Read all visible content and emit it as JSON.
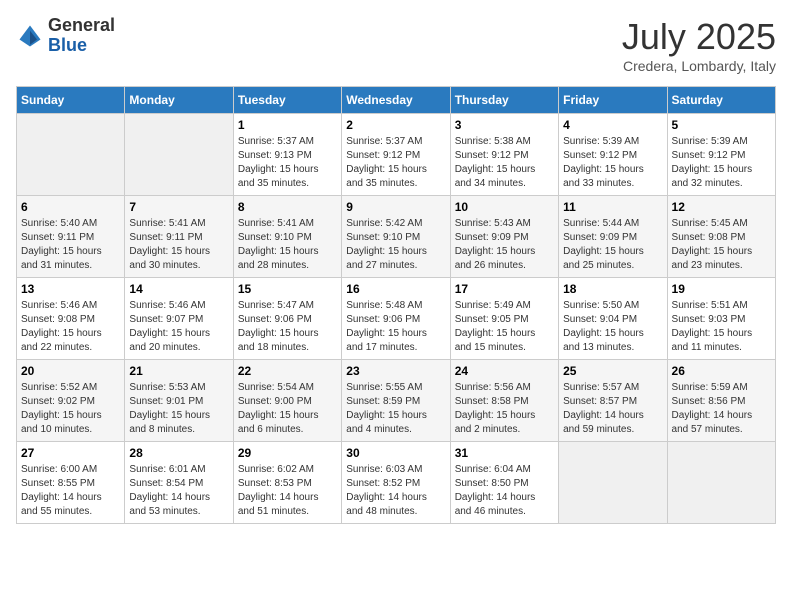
{
  "logo": {
    "general": "General",
    "blue": "Blue"
  },
  "title": "July 2025",
  "location": "Credera, Lombardy, Italy",
  "headers": [
    "Sunday",
    "Monday",
    "Tuesday",
    "Wednesday",
    "Thursday",
    "Friday",
    "Saturday"
  ],
  "weeks": [
    [
      {
        "day": "",
        "sunrise": "",
        "sunset": "",
        "daylight": ""
      },
      {
        "day": "",
        "sunrise": "",
        "sunset": "",
        "daylight": ""
      },
      {
        "day": "1",
        "sunrise": "Sunrise: 5:37 AM",
        "sunset": "Sunset: 9:13 PM",
        "daylight": "Daylight: 15 hours and 35 minutes."
      },
      {
        "day": "2",
        "sunrise": "Sunrise: 5:37 AM",
        "sunset": "Sunset: 9:12 PM",
        "daylight": "Daylight: 15 hours and 35 minutes."
      },
      {
        "day": "3",
        "sunrise": "Sunrise: 5:38 AM",
        "sunset": "Sunset: 9:12 PM",
        "daylight": "Daylight: 15 hours and 34 minutes."
      },
      {
        "day": "4",
        "sunrise": "Sunrise: 5:39 AM",
        "sunset": "Sunset: 9:12 PM",
        "daylight": "Daylight: 15 hours and 33 minutes."
      },
      {
        "day": "5",
        "sunrise": "Sunrise: 5:39 AM",
        "sunset": "Sunset: 9:12 PM",
        "daylight": "Daylight: 15 hours and 32 minutes."
      }
    ],
    [
      {
        "day": "6",
        "sunrise": "Sunrise: 5:40 AM",
        "sunset": "Sunset: 9:11 PM",
        "daylight": "Daylight: 15 hours and 31 minutes."
      },
      {
        "day": "7",
        "sunrise": "Sunrise: 5:41 AM",
        "sunset": "Sunset: 9:11 PM",
        "daylight": "Daylight: 15 hours and 30 minutes."
      },
      {
        "day": "8",
        "sunrise": "Sunrise: 5:41 AM",
        "sunset": "Sunset: 9:10 PM",
        "daylight": "Daylight: 15 hours and 28 minutes."
      },
      {
        "day": "9",
        "sunrise": "Sunrise: 5:42 AM",
        "sunset": "Sunset: 9:10 PM",
        "daylight": "Daylight: 15 hours and 27 minutes."
      },
      {
        "day": "10",
        "sunrise": "Sunrise: 5:43 AM",
        "sunset": "Sunset: 9:09 PM",
        "daylight": "Daylight: 15 hours and 26 minutes."
      },
      {
        "day": "11",
        "sunrise": "Sunrise: 5:44 AM",
        "sunset": "Sunset: 9:09 PM",
        "daylight": "Daylight: 15 hours and 25 minutes."
      },
      {
        "day": "12",
        "sunrise": "Sunrise: 5:45 AM",
        "sunset": "Sunset: 9:08 PM",
        "daylight": "Daylight: 15 hours and 23 minutes."
      }
    ],
    [
      {
        "day": "13",
        "sunrise": "Sunrise: 5:46 AM",
        "sunset": "Sunset: 9:08 PM",
        "daylight": "Daylight: 15 hours and 22 minutes."
      },
      {
        "day": "14",
        "sunrise": "Sunrise: 5:46 AM",
        "sunset": "Sunset: 9:07 PM",
        "daylight": "Daylight: 15 hours and 20 minutes."
      },
      {
        "day": "15",
        "sunrise": "Sunrise: 5:47 AM",
        "sunset": "Sunset: 9:06 PM",
        "daylight": "Daylight: 15 hours and 18 minutes."
      },
      {
        "day": "16",
        "sunrise": "Sunrise: 5:48 AM",
        "sunset": "Sunset: 9:06 PM",
        "daylight": "Daylight: 15 hours and 17 minutes."
      },
      {
        "day": "17",
        "sunrise": "Sunrise: 5:49 AM",
        "sunset": "Sunset: 9:05 PM",
        "daylight": "Daylight: 15 hours and 15 minutes."
      },
      {
        "day": "18",
        "sunrise": "Sunrise: 5:50 AM",
        "sunset": "Sunset: 9:04 PM",
        "daylight": "Daylight: 15 hours and 13 minutes."
      },
      {
        "day": "19",
        "sunrise": "Sunrise: 5:51 AM",
        "sunset": "Sunset: 9:03 PM",
        "daylight": "Daylight: 15 hours and 11 minutes."
      }
    ],
    [
      {
        "day": "20",
        "sunrise": "Sunrise: 5:52 AM",
        "sunset": "Sunset: 9:02 PM",
        "daylight": "Daylight: 15 hours and 10 minutes."
      },
      {
        "day": "21",
        "sunrise": "Sunrise: 5:53 AM",
        "sunset": "Sunset: 9:01 PM",
        "daylight": "Daylight: 15 hours and 8 minutes."
      },
      {
        "day": "22",
        "sunrise": "Sunrise: 5:54 AM",
        "sunset": "Sunset: 9:00 PM",
        "daylight": "Daylight: 15 hours and 6 minutes."
      },
      {
        "day": "23",
        "sunrise": "Sunrise: 5:55 AM",
        "sunset": "Sunset: 8:59 PM",
        "daylight": "Daylight: 15 hours and 4 minutes."
      },
      {
        "day": "24",
        "sunrise": "Sunrise: 5:56 AM",
        "sunset": "Sunset: 8:58 PM",
        "daylight": "Daylight: 15 hours and 2 minutes."
      },
      {
        "day": "25",
        "sunrise": "Sunrise: 5:57 AM",
        "sunset": "Sunset: 8:57 PM",
        "daylight": "Daylight: 14 hours and 59 minutes."
      },
      {
        "day": "26",
        "sunrise": "Sunrise: 5:59 AM",
        "sunset": "Sunset: 8:56 PM",
        "daylight": "Daylight: 14 hours and 57 minutes."
      }
    ],
    [
      {
        "day": "27",
        "sunrise": "Sunrise: 6:00 AM",
        "sunset": "Sunset: 8:55 PM",
        "daylight": "Daylight: 14 hours and 55 minutes."
      },
      {
        "day": "28",
        "sunrise": "Sunrise: 6:01 AM",
        "sunset": "Sunset: 8:54 PM",
        "daylight": "Daylight: 14 hours and 53 minutes."
      },
      {
        "day": "29",
        "sunrise": "Sunrise: 6:02 AM",
        "sunset": "Sunset: 8:53 PM",
        "daylight": "Daylight: 14 hours and 51 minutes."
      },
      {
        "day": "30",
        "sunrise": "Sunrise: 6:03 AM",
        "sunset": "Sunset: 8:52 PM",
        "daylight": "Daylight: 14 hours and 48 minutes."
      },
      {
        "day": "31",
        "sunrise": "Sunrise: 6:04 AM",
        "sunset": "Sunset: 8:50 PM",
        "daylight": "Daylight: 14 hours and 46 minutes."
      },
      {
        "day": "",
        "sunrise": "",
        "sunset": "",
        "daylight": ""
      },
      {
        "day": "",
        "sunrise": "",
        "sunset": "",
        "daylight": ""
      }
    ]
  ]
}
